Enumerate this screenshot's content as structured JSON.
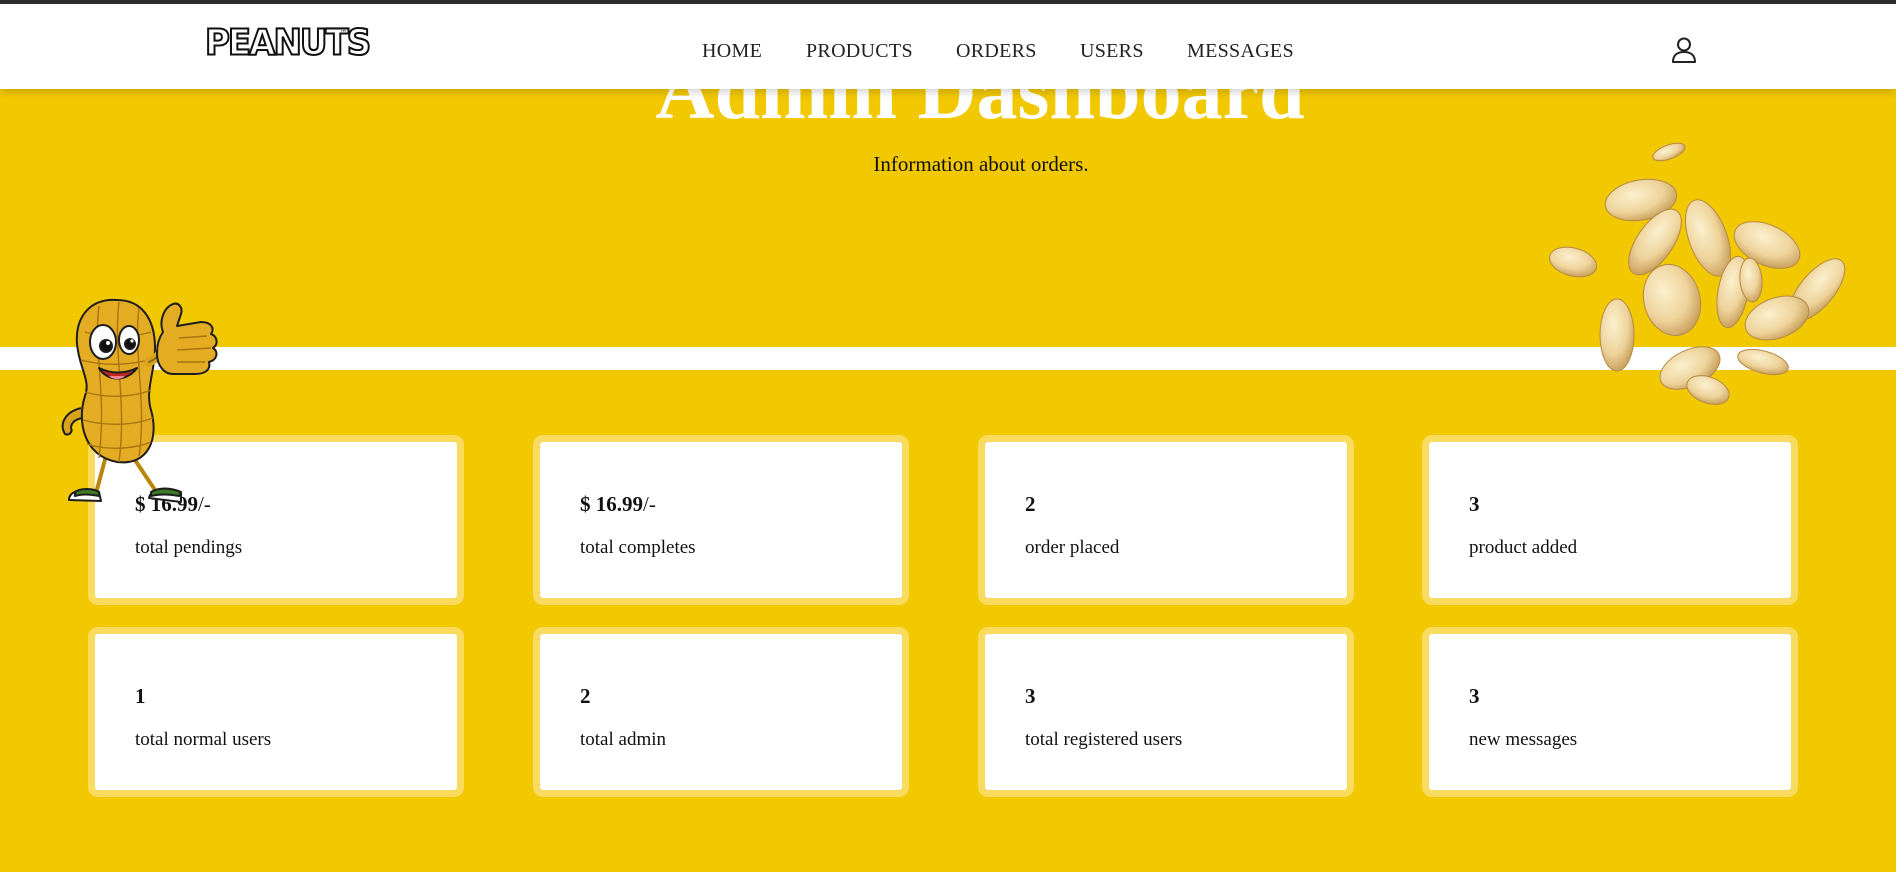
{
  "header": {
    "logo_text": "PEANUTS",
    "logo_tm": "™",
    "nav": [
      {
        "label": "HOME"
      },
      {
        "label": "PRODUCTS"
      },
      {
        "label": "ORDERS"
      },
      {
        "label": "USERS"
      },
      {
        "label": "MESSAGES"
      }
    ],
    "user_icon": "user-icon"
  },
  "hero": {
    "title": "Admin Dashboard",
    "subtitle": "Information about orders."
  },
  "cards": [
    {
      "value": "$ 16.99",
      "suffix": "/-",
      "label": "total pendings"
    },
    {
      "value": "$ 16.99",
      "suffix": "/-",
      "label": "total completes"
    },
    {
      "value": "2",
      "suffix": "",
      "label": "order placed"
    },
    {
      "value": "3",
      "suffix": "",
      "label": "product added"
    },
    {
      "value": "1",
      "suffix": "",
      "label": "total normal users"
    },
    {
      "value": "2",
      "suffix": "",
      "label": "total admin"
    },
    {
      "value": "3",
      "suffix": "",
      "label": "total registered users"
    },
    {
      "value": "3",
      "suffix": "",
      "label": "new messages"
    }
  ],
  "colors": {
    "background": "#f2c800",
    "card_border": "#f8db5f",
    "card_bg": "#ffffff",
    "header_bg": "#ffffff"
  }
}
